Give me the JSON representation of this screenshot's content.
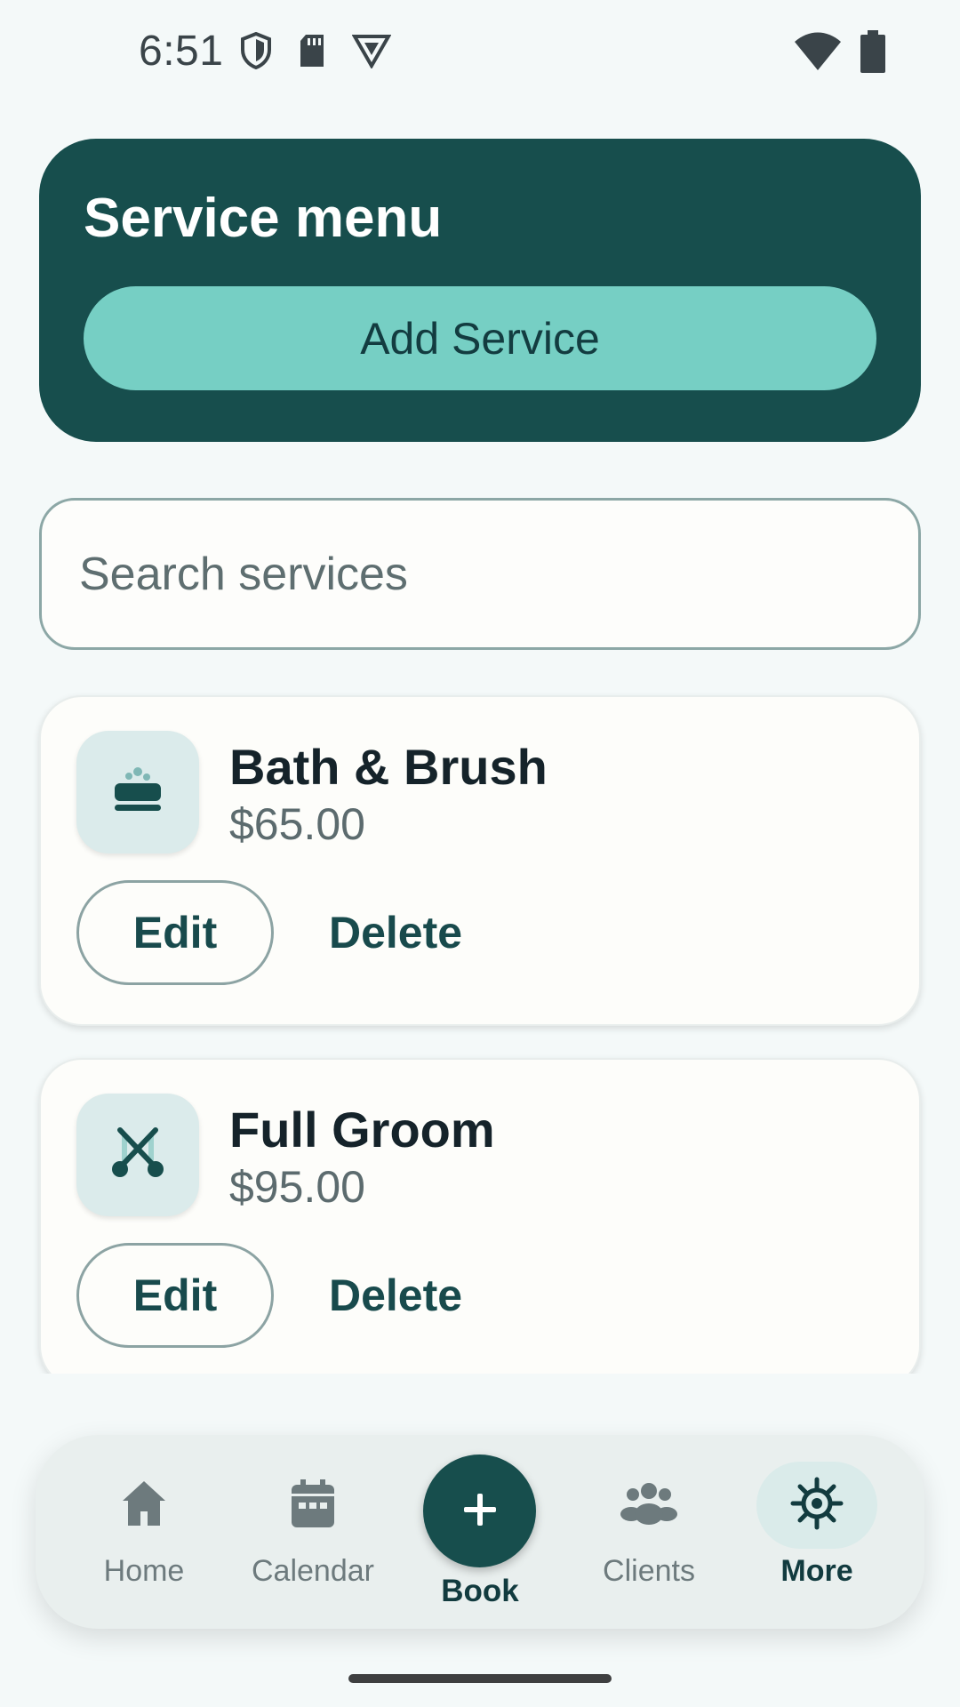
{
  "status_bar": {
    "time": "6:51",
    "icons_left": [
      "shield-icon",
      "sd-card-icon",
      "vpn-icon"
    ],
    "icons_right": [
      "wifi-icon",
      "battery-icon"
    ]
  },
  "header": {
    "title": "Service menu",
    "add_button_label": "Add Service"
  },
  "search": {
    "placeholder": "Search services",
    "value": ""
  },
  "services": [
    {
      "icon": "bath-icon",
      "name": "Bath & Brush",
      "price": "$65.00",
      "edit_label": "Edit",
      "delete_label": "Delete"
    },
    {
      "icon": "scissors-icon",
      "name": "Full Groom",
      "price": "$95.00",
      "edit_label": "Edit",
      "delete_label": "Delete"
    }
  ],
  "bottom_nav": {
    "items": [
      {
        "label": "Home",
        "icon": "home-icon",
        "active": false
      },
      {
        "label": "Calendar",
        "icon": "calendar-icon",
        "active": false
      },
      {
        "label": "Book",
        "icon": "plus-icon",
        "active": false
      },
      {
        "label": "Clients",
        "icon": "clients-icon",
        "active": false
      },
      {
        "label": "More",
        "icon": "gear-icon",
        "active": true
      }
    ]
  },
  "colors": {
    "primary": "#174E4D",
    "accent": "#76CFC4",
    "background": "#F4F9F9",
    "card": "#FDFDFA"
  }
}
